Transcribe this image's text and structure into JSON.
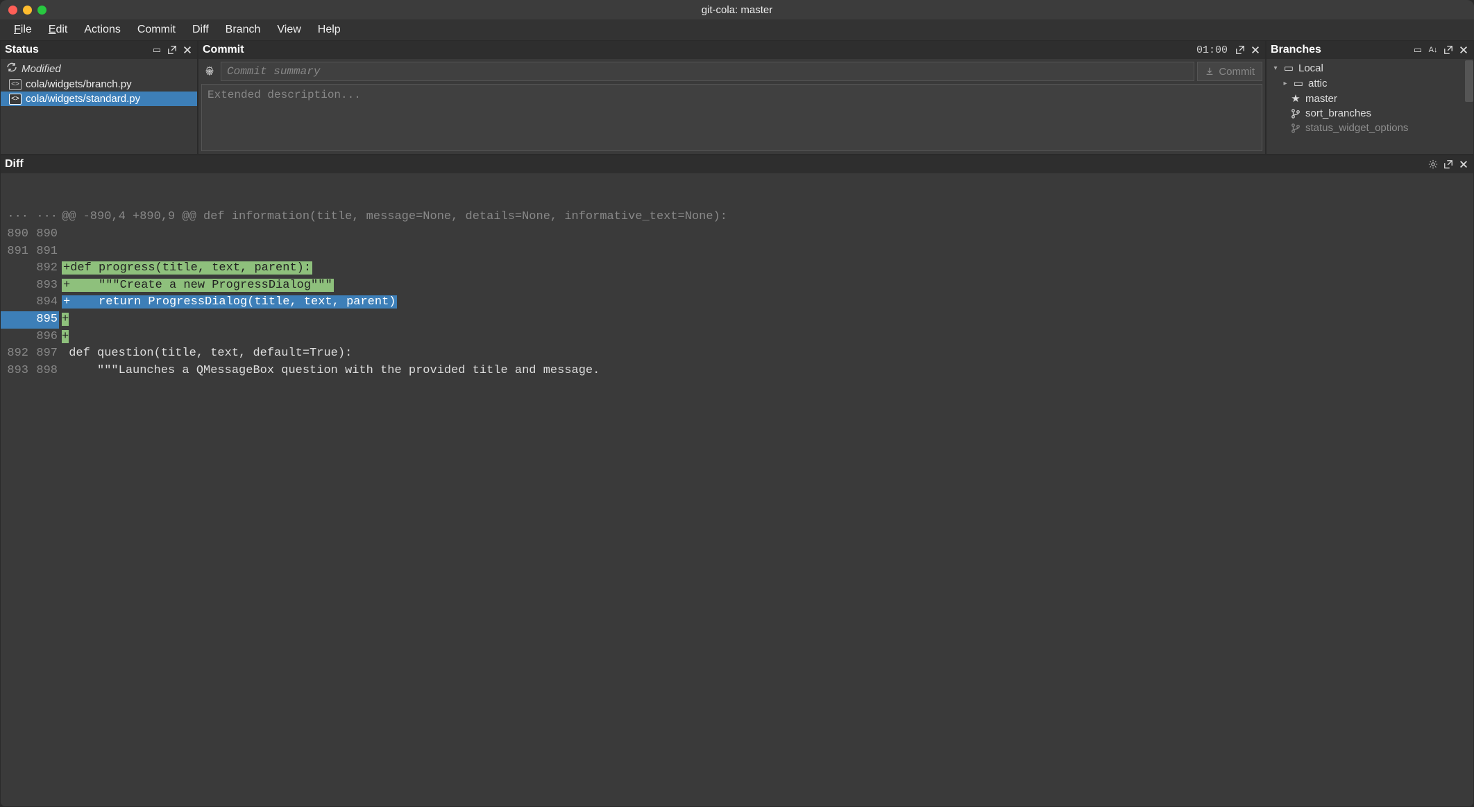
{
  "window": {
    "title": "git-cola: master"
  },
  "menubar": {
    "items": [
      "File",
      "Edit",
      "Actions",
      "Commit",
      "Diff",
      "Branch",
      "View",
      "Help"
    ]
  },
  "status": {
    "title": "Status",
    "group_label": "Modified",
    "files": [
      {
        "path": "cola/widgets/branch.py",
        "selected": false
      },
      {
        "path": "cola/widgets/standard.py",
        "selected": true
      }
    ]
  },
  "commit": {
    "title": "Commit",
    "clock": "01:00",
    "summary_placeholder": "Commit summary",
    "summary_value": "",
    "description_placeholder": "Extended description...",
    "description_value": "",
    "button_label": "Commit"
  },
  "branches": {
    "title": "Branches",
    "root_label": "Local",
    "items": [
      {
        "icon": "folder",
        "label": "attic",
        "expandable": true
      },
      {
        "icon": "star",
        "label": "master",
        "expandable": false
      },
      {
        "icon": "branch",
        "label": "sort_branches",
        "expandable": false
      },
      {
        "icon": "branch",
        "label": "status_widget_options",
        "expandable": false
      }
    ]
  },
  "diff": {
    "title": "Diff",
    "lines": [
      {
        "old": "...",
        "new": "...",
        "type": "hunk",
        "text": "@@ -890,4 +890,9 @@ def information(title, message=None, details=None, informative_text=None):"
      },
      {
        "old": "890",
        "new": "890",
        "type": "ctx",
        "text": ""
      },
      {
        "old": "891",
        "new": "891",
        "type": "ctx",
        "text": ""
      },
      {
        "old": "",
        "new": "892",
        "type": "addg",
        "text": "+def progress(title, text, parent):"
      },
      {
        "old": "",
        "new": "893",
        "type": "addg",
        "text": "+    \"\"\"Create a new ProgressDialog\"\"\""
      },
      {
        "old": "",
        "new": "894",
        "type": "addsel",
        "text": "+    return ProgressDialog(title, text, parent)"
      },
      {
        "old": "",
        "new": "895",
        "type": "addplus",
        "text": "+"
      },
      {
        "old": "",
        "new": "896",
        "type": "addplus2",
        "text": "+"
      },
      {
        "old": "892",
        "new": "897",
        "type": "ctx",
        "text": " def question(title, text, default=True):"
      },
      {
        "old": "893",
        "new": "898",
        "type": "ctx",
        "text": "     \"\"\"Launches a QMessageBox question with the provided title and message."
      }
    ]
  }
}
